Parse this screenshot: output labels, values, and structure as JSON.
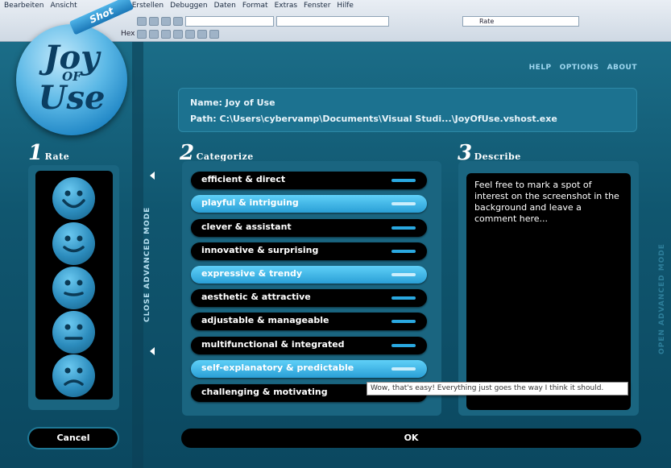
{
  "host": {
    "menu": [
      "Bearbeiten",
      "Ansicht",
      "Erstellen",
      "Debuggen",
      "Daten",
      "Format",
      "Extras",
      "Fenster",
      "Hilfe"
    ],
    "toolbar_label": "Hex",
    "rate_field": "Rate"
  },
  "logo": {
    "line1": "Joy",
    "line2": "OF",
    "line3": "Use",
    "ribbon": "Shot"
  },
  "nav": {
    "help": "HELP",
    "options": "OPTIONS",
    "about": "ABOUT"
  },
  "info": {
    "name": "Name: Joy of Use",
    "path": "Path: C:\\Users\\cybervamp\\Documents\\Visual Studi...\\JoyOfUse.vshost.exe"
  },
  "sections": {
    "rate": {
      "num": "1",
      "title": "Rate"
    },
    "categorize": {
      "num": "2",
      "title": "Categorize"
    },
    "describe": {
      "num": "3",
      "title": "Describe"
    }
  },
  "categories": [
    {
      "label": "efficient & direct",
      "selected": false
    },
    {
      "label": "playful & intriguing",
      "selected": true
    },
    {
      "label": "clever & assistant",
      "selected": false
    },
    {
      "label": "innovative & surprising",
      "selected": false
    },
    {
      "label": "expressive & trendy",
      "selected": true
    },
    {
      "label": "aesthetic & attractive",
      "selected": false
    },
    {
      "label": "adjustable & manageable",
      "selected": false
    },
    {
      "label": "multifunctional & integrated",
      "selected": false
    },
    {
      "label": "self-explanatory & predictable",
      "selected": true
    },
    {
      "label": "challenging & motivating",
      "selected": false
    }
  ],
  "tooltip": "Wow, that's easy! Everything just goes the way I think it should.",
  "advanced": {
    "close": "CLOSE ADVANCED MODE",
    "open": "OPEN ADVANCED MODE"
  },
  "describe_text": "Feel free to mark a spot of interest on the screenshot in the background and leave a comment here...",
  "buttons": {
    "cancel": "Cancel",
    "ok": "OK"
  },
  "colors": {
    "background": "#10566f",
    "panel": "#1a6580",
    "accent": "#2aa8e0",
    "selected": "#3fb6e8"
  }
}
